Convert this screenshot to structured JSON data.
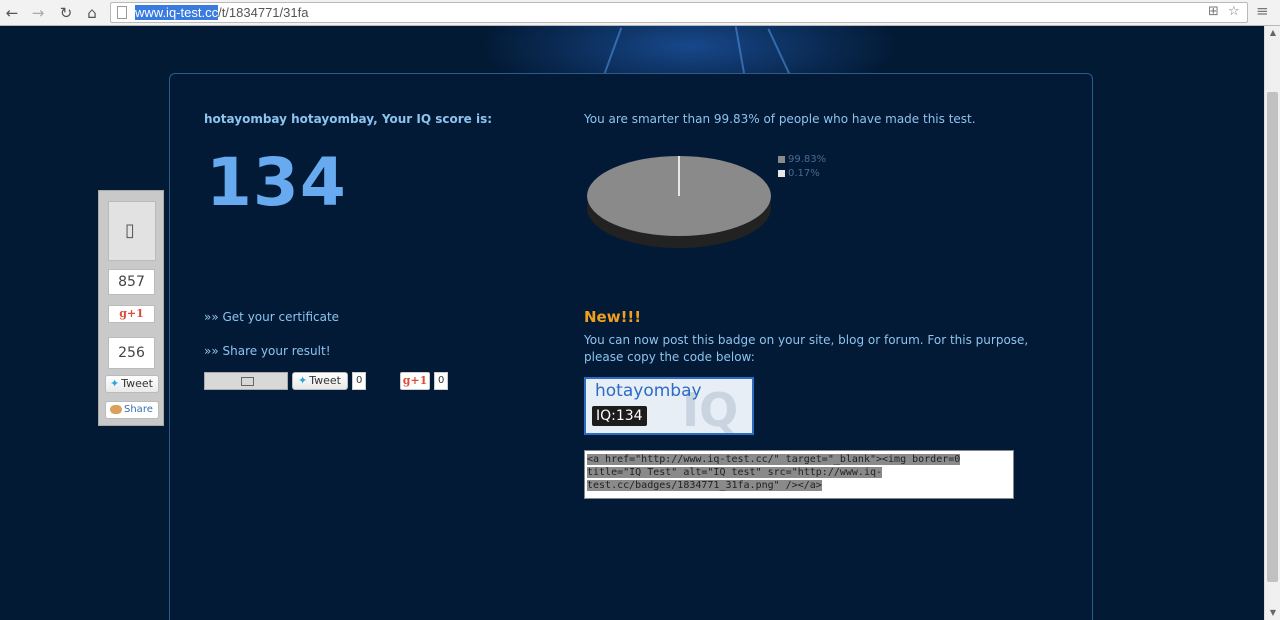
{
  "browser": {
    "url_selected": "www.iq-test.cc",
    "url_rest": "/t/1834771/31fa"
  },
  "result": {
    "title": "hotayombay hotayombay, Your IQ score is:",
    "score": "134",
    "smarter_text": "You are smarter than 99.83% of people who have made this test."
  },
  "pie": {
    "slices": [
      {
        "label": "99.83%",
        "value": 99.83,
        "color": "#8a8a8a"
      },
      {
        "label": "0.17%",
        "value": 0.17,
        "color": "#e6e6e6"
      }
    ]
  },
  "links": {
    "certificate": "»» Get your certificate",
    "share": "»» Share your result!"
  },
  "share_row": {
    "tweet_label": "Tweet",
    "tweet_count": "0",
    "gplus_label": "g+1",
    "gplus_count": "0"
  },
  "badge_section": {
    "title": "New!!!",
    "description": "You can now post this badge on your site, blog or forum. For this purpose, please copy the code below:",
    "badge_name": "hotayombay",
    "badge_iq": "IQ:134",
    "badge_bg": "IQ",
    "code": "<a href=\"http://www.iq-test.cc/\" target=\"_blank\"><img border=0 title=\"IQ Test\" alt=\"IQ test\" src=\"http://www.iq-test.cc/badges/1834771_31fa.png\" /></a>"
  },
  "side_widget": {
    "count_top": "857",
    "gplus_label": "g+1",
    "count_second": "256",
    "tweet_label": "Tweet",
    "share_label": "Share"
  }
}
